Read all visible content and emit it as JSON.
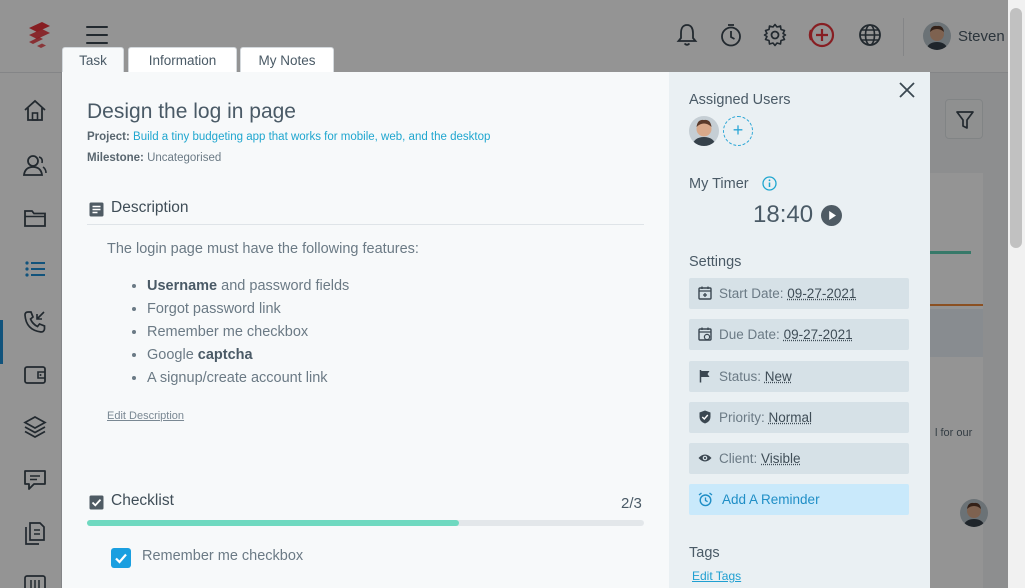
{
  "header": {
    "user_name": "Steven",
    "icons": [
      "logo-icon",
      "menu-icon",
      "bell-icon",
      "timer-icon",
      "gear-icon",
      "add-circle-icon",
      "globe-icon"
    ]
  },
  "sidebar": {
    "icons": [
      "home-icon",
      "users-icon",
      "folder-icon",
      "list-icon",
      "phone-icon",
      "wallet-icon",
      "layers-icon",
      "chat-icon",
      "documents-icon",
      "sliders-icon"
    ],
    "active_index": 3
  },
  "background": {
    "snippet": "l for our"
  },
  "modal": {
    "tabs": [
      {
        "label": "Task",
        "active": true
      },
      {
        "label": "Information",
        "active": false
      },
      {
        "label": "My Notes",
        "active": false
      }
    ],
    "title": "Design the log in page",
    "project_label": "Project:",
    "project_value": "Build a tiny budgeting app that works for mobile, web, and the desktop",
    "milestone_label": "Milestone:",
    "milestone_value": "Uncategorised",
    "description": {
      "heading": "Description",
      "intro": "The login page must have the following features:",
      "items": [
        {
          "bold": "Username",
          "rest": " and password fields"
        },
        {
          "bold": "",
          "rest": "Forgot password link"
        },
        {
          "bold": "",
          "rest": "Remember me checkbox"
        },
        {
          "pre": "Google ",
          "bold": "captcha",
          "rest": ""
        },
        {
          "bold": "",
          "rest": "A signup/create account link"
        }
      ],
      "edit_label": "Edit Description"
    },
    "checklist": {
      "heading": "Checklist",
      "count": "2/3",
      "progress": 0.667,
      "items": [
        {
          "label": "Remember me checkbox",
          "checked": true
        }
      ]
    },
    "right": {
      "assigned_heading": "Assigned Users",
      "add_user_symbol": "+",
      "timer_heading": "My Timer",
      "timer_value": "18:40",
      "settings_heading": "Settings",
      "settings": [
        {
          "icon": "calendar-plus-icon",
          "label": "Start Date:",
          "value": "09-27-2021"
        },
        {
          "icon": "calendar-clock-icon",
          "label": "Due Date:",
          "value": "09-27-2021"
        },
        {
          "icon": "flag-icon",
          "label": "Status:",
          "value": "New"
        },
        {
          "icon": "shield-check-icon",
          "label": "Priority:",
          "value": "Normal"
        },
        {
          "icon": "eye-icon",
          "label": "Client:",
          "value": "Visible"
        }
      ],
      "reminder_label": "Add A Reminder",
      "tags_heading": "Tags",
      "edit_tags_label": "Edit Tags"
    }
  },
  "colors": {
    "accent": "#1fa6cf",
    "checkbox": "#1a9fe0",
    "progress": "#6fd9c0",
    "logo": "#e8343b",
    "right_panel": "#eaf0f3",
    "reminder_bg": "#c9e9fb"
  }
}
